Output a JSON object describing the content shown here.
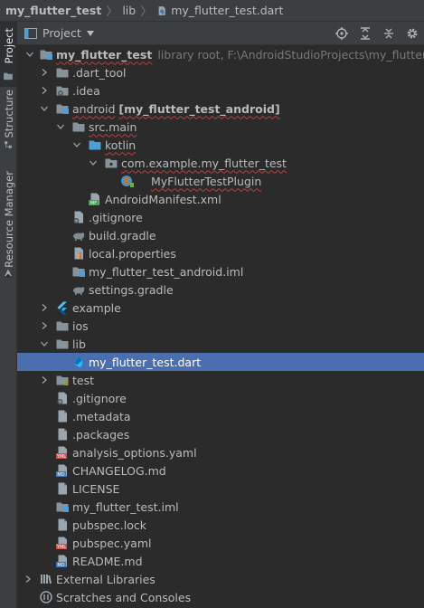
{
  "breadcrumb": {
    "project": "my_flutter_test",
    "folder": "lib",
    "file": "my_flutter_test.dart"
  },
  "side_tabs": {
    "project": "Project",
    "structure": "Structure",
    "resource_manager": "Resource Manager"
  },
  "panel": {
    "title": "Project",
    "actions": [
      "locate-icon",
      "expand-all-icon",
      "collapse-all-icon",
      "settings-icon"
    ]
  },
  "tree": {
    "root": {
      "name": "my_flutter_test",
      "secondary": "library root,  F:\\AndroidStudioProjects\\my_flutter_test"
    },
    "dart_tool": ".dart_tool",
    "idea": ".idea",
    "android": {
      "name": "android",
      "module": "[my_flutter_test_android]"
    },
    "src_main": "src.main",
    "kotlin": "kotlin",
    "package": "com.example.my_flutter_test",
    "plugin_class": "MyFlutterTestPlugin",
    "android_manifest": "AndroidManifest.xml",
    "android_gitignore": ".gitignore",
    "build_gradle": "build.gradle",
    "local_properties": "local.properties",
    "android_iml": "my_flutter_test_android.iml",
    "settings_gradle": "settings.gradle",
    "example": "example",
    "ios": "ios",
    "lib": "lib",
    "main_dart": "my_flutter_test.dart",
    "test": "test",
    "gitignore": ".gitignore",
    "metadata": ".metadata",
    "packages": ".packages",
    "analysis_options": "analysis_options.yaml",
    "changelog": "CHANGELOG.md",
    "license": "LICENSE",
    "project_iml": "my_flutter_test.iml",
    "pubspec_lock": "pubspec.lock",
    "pubspec_yaml": "pubspec.yaml",
    "readme": "README.md",
    "external_libraries": "External Libraries",
    "scratches": "Scratches and Consoles"
  },
  "colors": {
    "background": "#2b2b2b",
    "chrome": "#3c3f41",
    "selection": "#4b6eaf",
    "text": "#bbbbbb",
    "folder": "#87939a",
    "source_folder": "#4c9fd4",
    "error_underline": "#bc3f3c"
  }
}
